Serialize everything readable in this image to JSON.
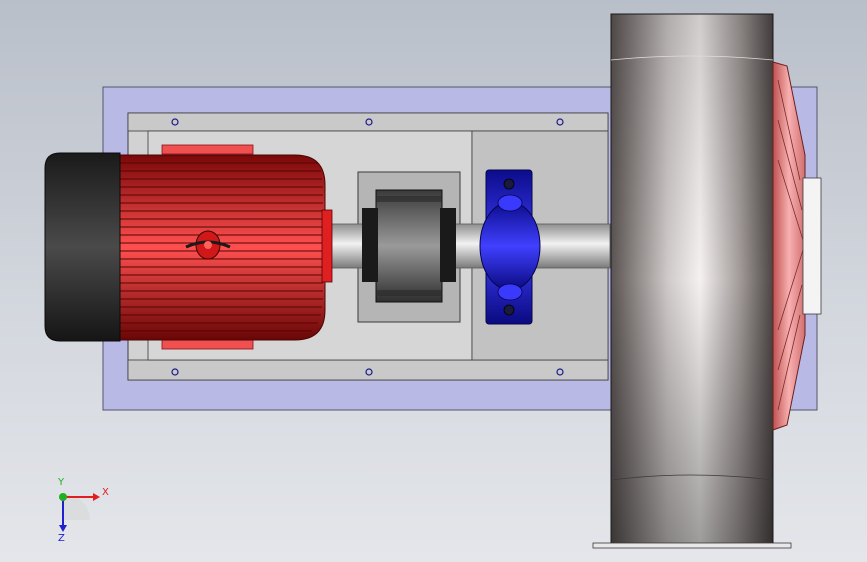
{
  "viewport": {
    "background_top": "#b9bfc9",
    "background_bottom": "#e4e6ea"
  },
  "model": {
    "parts": [
      "base-plate",
      "mounting-frame",
      "electric-motor",
      "shaft-coupling",
      "pillow-block-bearing",
      "drive-shaft",
      "blower-housing",
      "inlet-flange"
    ],
    "colors": {
      "base_plate": "#b9b9e6",
      "frame": "#d2d2d2",
      "motor_body": "#e01a1a",
      "motor_end_cap": "#2b2b2b",
      "motor_feet": "#f05050",
      "coupling": "#555555",
      "bearing": "#1a1ad8",
      "shaft": "#b8b8b8",
      "blower_housing": "#9a9392",
      "inlet_cone": "#e88a8a"
    }
  },
  "triad": {
    "x_label": "X",
    "y_label": "Y",
    "z_label": "Z",
    "x_color": "#e02020",
    "y_color": "#20b020",
    "z_color": "#2020d0"
  }
}
